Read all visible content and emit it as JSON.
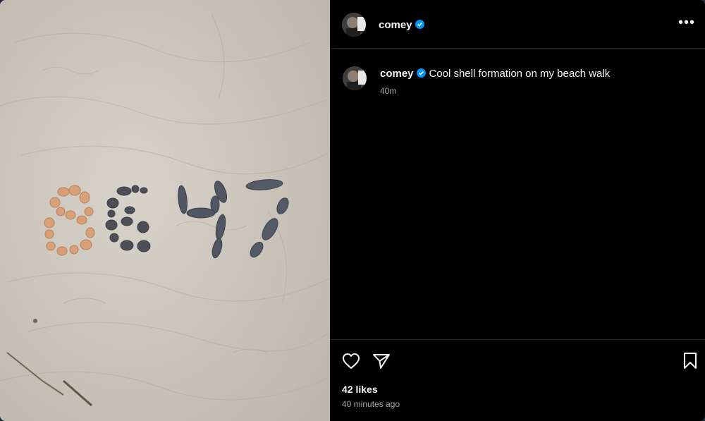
{
  "post": {
    "username": "comey",
    "caption": "Cool shell formation on my beach walk",
    "caption_time": "40m",
    "likes": "42 likes",
    "posted_ago": "40 minutes ago",
    "more_label": "•••"
  },
  "icons": {
    "verified": "verified-badge-icon",
    "like": "heart-icon",
    "share": "send-icon",
    "save": "bookmark-icon",
    "more": "more-options-icon"
  },
  "colors": {
    "verified_blue": "#0095f6",
    "panel_bg": "#000000",
    "secondary_text": "#a8a8a8"
  }
}
